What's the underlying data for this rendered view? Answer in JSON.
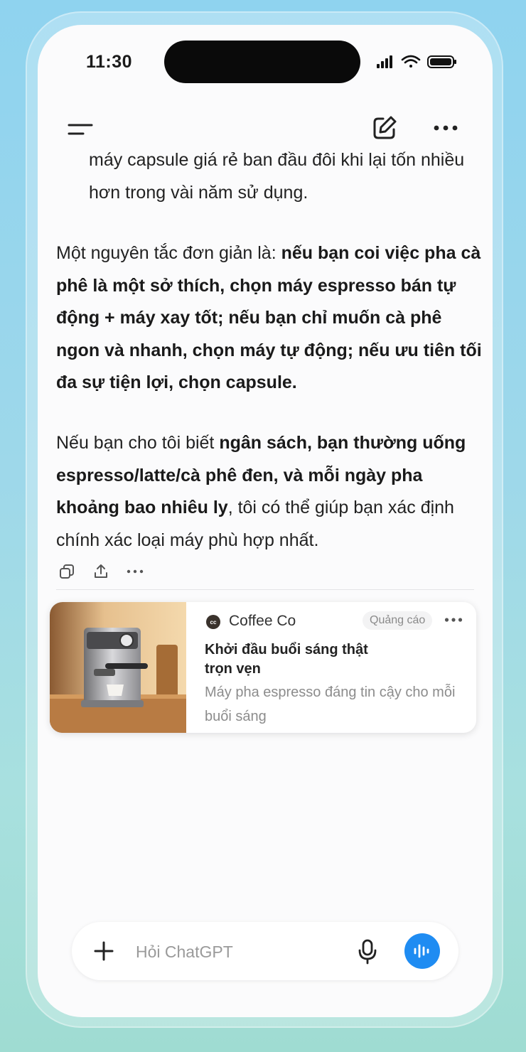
{
  "status_bar": {
    "time": "11:30"
  },
  "toolbar": {
    "menu_icon": "menu-icon",
    "compose_icon": "compose-icon",
    "more_icon": "more-icon"
  },
  "message": {
    "p1": "máy capsule giá rẻ ban đầu đôi khi lại tốn nhiều hơn trong vài năm sử dụng.",
    "p2_intro": "Một nguyên tắc đơn giản là: ",
    "p2_bold": "nếu bạn coi việc pha cà phê là một sở thích, chọn máy espresso bán tự động + máy xay tốt; nếu bạn chỉ muốn cà phê ngon và nhanh, chọn máy tự động; nếu ưu tiên tối đa sự tiện lợi, chọn capsule.",
    "p3_intro": "Nếu bạn cho tôi biết ",
    "p3_bold": "ngân sách, bạn thường uống espresso/latte/cà phê đen, và mỗi ngày pha khoảng bao nhiêu ly",
    "p3_rest": ", tôi có thể giúp bạn xác định chính xác loại máy phù hợp nhất."
  },
  "actions": [
    "copy-icon",
    "share-icon",
    "more-icon"
  ],
  "ad": {
    "brand": "Coffee Co",
    "logo_text": "cc",
    "label": "Quảng cáo",
    "headline": "Khởi đầu buổi sáng thật trọn vẹn",
    "description": "Máy pha espresso đáng tin cậy cho mỗi buổi sáng"
  },
  "composer": {
    "placeholder": "Hỏi ChatGPT"
  },
  "colors": {
    "accent": "#1f8cf2",
    "background": "#fbfbfc"
  }
}
